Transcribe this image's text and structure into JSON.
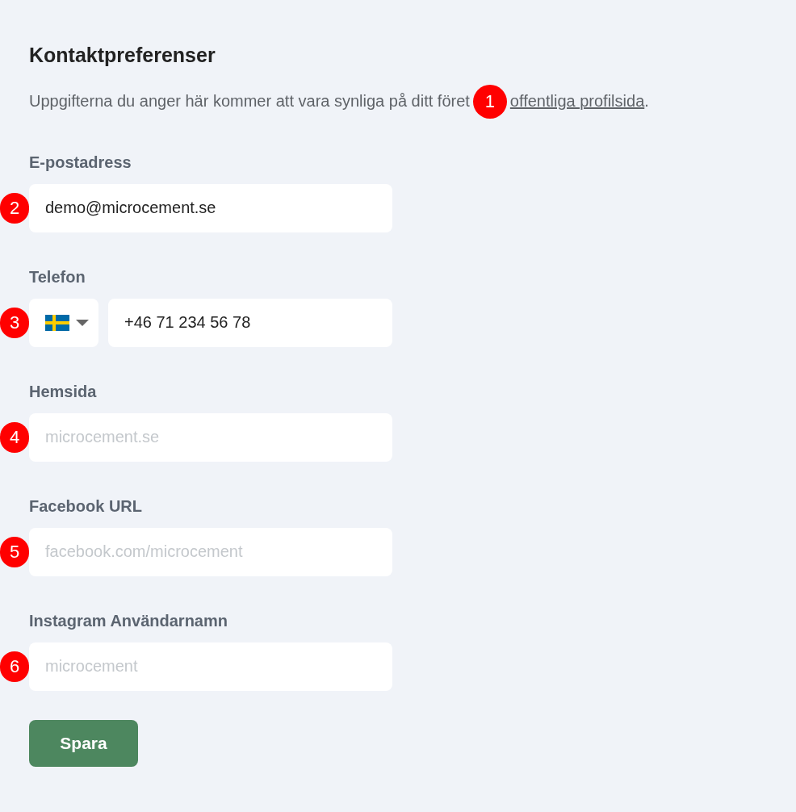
{
  "heading": "Kontaktpreferenser",
  "description": {
    "text": "Uppgifterna du anger här kommer att vara synliga på ditt föret",
    "marker": "1",
    "link": "offentliga profilsida",
    "end": "."
  },
  "fields": [
    {
      "kind": "text",
      "label": "E-postadress",
      "marker": "2",
      "value": "demo@microcement.se"
    },
    {
      "kind": "phone",
      "label": "Telefon",
      "marker": "3",
      "value": "+46 71 234 56 78"
    },
    {
      "kind": "text",
      "label": "Hemsida",
      "marker": "4",
      "placeholder": "microcement.se"
    },
    {
      "kind": "text",
      "label": "Facebook URL",
      "marker": "5",
      "placeholder": "facebook.com/microcement"
    },
    {
      "kind": "text",
      "label": "Instagram Användarnamn",
      "marker": "6",
      "placeholder": "microcement"
    }
  ],
  "save_button": "Spara"
}
